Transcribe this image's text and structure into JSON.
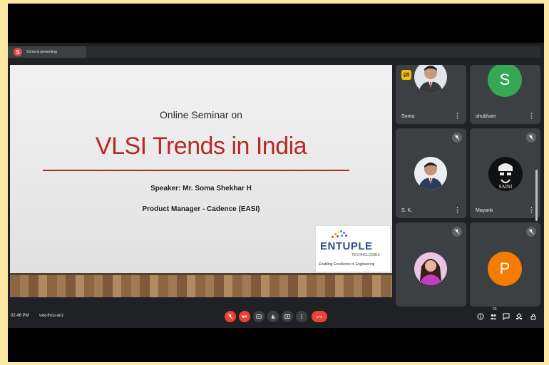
{
  "topbar": {
    "presenter_initial": "S",
    "presenting_text": "Soma is presenting"
  },
  "slide": {
    "line1": "Online Seminar on",
    "title": "VLSI Trends in India",
    "speaker": "Speaker: Mr. Soma Shekhar H",
    "role": "Product Manager - Cadence (EASI)",
    "logo": {
      "name": "ENTUPLE",
      "sub": "TECHNOLOGIES",
      "tagline": "Enabling Excellence in Engineering"
    }
  },
  "participants": [
    {
      "name": "Soma",
      "type": "photo",
      "presenting": true
    },
    {
      "name": "shubham",
      "type": "letter",
      "initial": "S",
      "color": "#34a853"
    },
    {
      "name": "S. K.",
      "type": "photo",
      "muted": true
    },
    {
      "name": "Mayank",
      "type": "photo",
      "muted": true
    },
    {
      "name": "",
      "type": "photo",
      "muted": true
    },
    {
      "name": "",
      "type": "letter",
      "initial": "P",
      "color": "#f57c00",
      "muted": true
    }
  ],
  "bottombar": {
    "time": "02:46 PM",
    "meeting_code": "vxe-fncu-unz",
    "participant_count": "23"
  },
  "colors": {
    "accent_red": "#ea4335",
    "slide_red": "#b52a24",
    "bg": "#202124"
  }
}
